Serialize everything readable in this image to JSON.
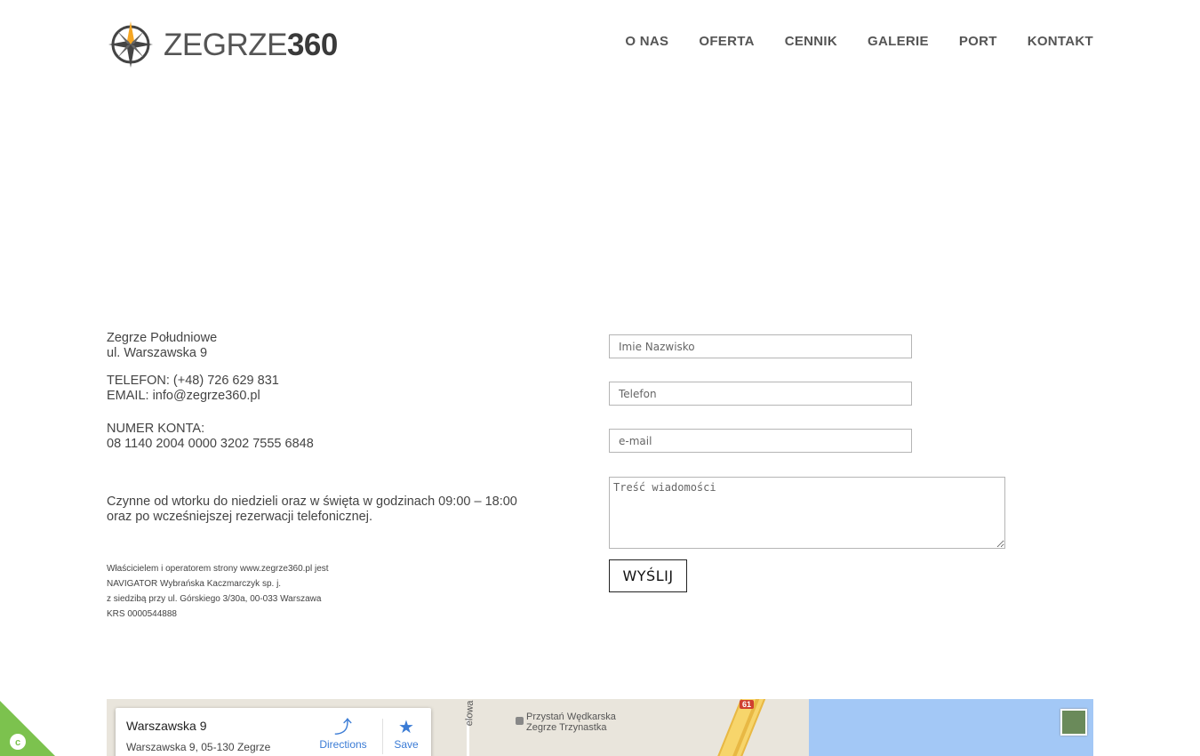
{
  "brand": {
    "name_light": "ZEGRZE",
    "name_bold": "360",
    "accent": "#f5a623"
  },
  "nav": [
    "O NAS",
    "OFERTA",
    "CENNIK",
    "GALERIE",
    "PORT",
    "KONTAKT"
  ],
  "contact": {
    "address_line1": "Zegrze Południowe",
    "address_line2": "ul. Warszawska 9",
    "phone": "TELEFON: (+48) 726 629 831",
    "email": "EMAIL: info@zegrze360.pl",
    "account_label": "NUMER KONTA:",
    "account_number": "08 1140 2004 0000 3202 7555 6848",
    "hours_line1": "Czynne od wtorku do niedzieli oraz w święta w godzinach 09:00 – 18:00",
    "hours_line2": "oraz po wcześniejszej rezerwacji telefonicznej."
  },
  "legal": [
    "Właścicielem i operatorem strony www.zegrze360.pl jest",
    "NAVIGATOR Wybrańska Kaczmarczyk sp. j.",
    "z siedzibą przy ul. Górskiego 3/30a, 00-033 Warszawa",
    "KRS 0000544888"
  ],
  "form": {
    "name_placeholder": "Imie Nazwisko",
    "phone_placeholder": "Telefon",
    "email_placeholder": "e-mail",
    "message_placeholder": "Treść wiadomości",
    "submit_label": "WYŚLIJ"
  },
  "map": {
    "card_title": "Warszawska 9",
    "card_address": "Warszawska 9, 05-130 Zegrze",
    "directions_label": "Directions",
    "save_label": "Save",
    "poi_line1": "Przystań Wędkarska",
    "poi_line2": "Zegrze Trzynastka",
    "street_label": "elowa",
    "route_number": "61"
  },
  "icons": {
    "logo": "compass-icon",
    "directions": "directions-icon",
    "save": "star-icon",
    "cookie": "cookie-icon"
  }
}
